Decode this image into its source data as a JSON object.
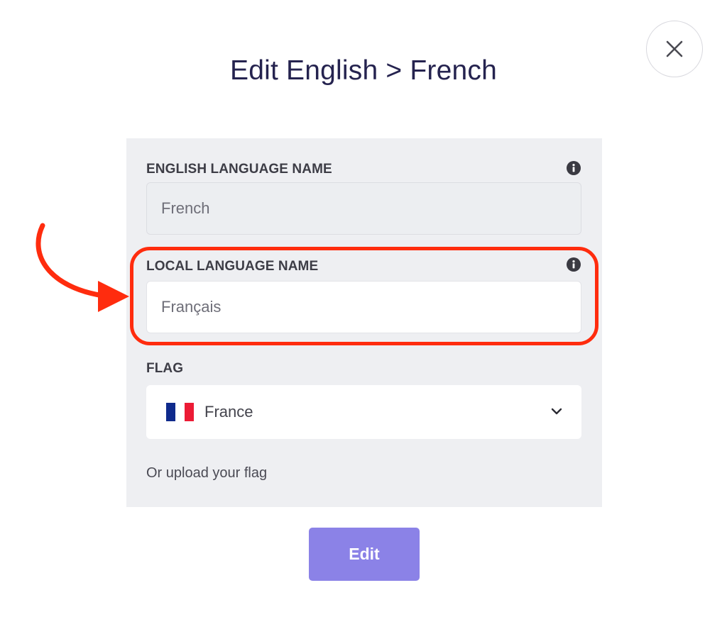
{
  "dialog": {
    "title": "Edit English > French",
    "close_icon": "close-icon"
  },
  "form": {
    "english_name": {
      "label": "ENGLISH LANGUAGE NAME",
      "value": "French",
      "disabled": true,
      "info_icon": "info-icon"
    },
    "local_name": {
      "label": "LOCAL LANGUAGE NAME",
      "value": "Français",
      "info_icon": "info-icon"
    },
    "flag": {
      "label": "FLAG",
      "selected": "France",
      "flag_colors": [
        "#0f2a8c",
        "#ffffff",
        "#ec1b35"
      ],
      "chevron_icon": "chevron-down-icon"
    },
    "upload_text": "Or upload your flag"
  },
  "actions": {
    "edit_label": "Edit"
  },
  "annotation": {
    "highlight_color": "#ff2c0e",
    "arrow_icon": "curved-arrow-icon"
  }
}
